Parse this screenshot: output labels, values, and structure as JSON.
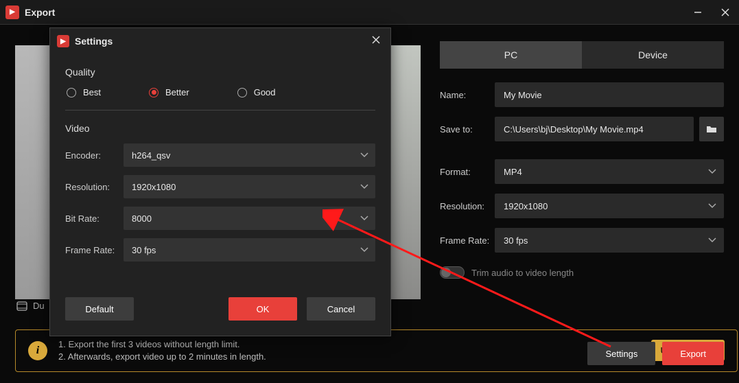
{
  "window": {
    "title": "Export"
  },
  "tabs": {
    "pc": "PC",
    "device": "Device"
  },
  "form": {
    "name_label": "Name:",
    "name_value": "My Movie",
    "save_label": "Save to:",
    "save_value": "C:\\Users\\bj\\Desktop\\My Movie.mp4",
    "format_label": "Format:",
    "format_value": "MP4",
    "resolution_label": "Resolution:",
    "resolution_value": "1920x1080",
    "framerate_label": "Frame Rate:",
    "framerate_value": "30 fps"
  },
  "toggle": {
    "label": "Trim audio to video length"
  },
  "buttons": {
    "settings": "Settings",
    "export": "Export"
  },
  "duration_prefix": "Du",
  "banner": {
    "line1": "1. Export the first 3 videos without length limit.",
    "line2": "2. Afterwards, export video up to 2 minutes in length.",
    "upgrade": "Upgrade Now"
  },
  "modal": {
    "title": "Settings",
    "quality_heading": "Quality",
    "quality_options": {
      "best": "Best",
      "better": "Better",
      "good": "Good"
    },
    "video_heading": "Video",
    "encoder_label": "Encoder:",
    "encoder_value": "h264_qsv",
    "resolution_label": "Resolution:",
    "resolution_value": "1920x1080",
    "bitrate_label": "Bit Rate:",
    "bitrate_value": "8000",
    "framerate_label": "Frame Rate:",
    "framerate_value": "30 fps",
    "default_btn": "Default",
    "ok_btn": "OK",
    "cancel_btn": "Cancel"
  }
}
